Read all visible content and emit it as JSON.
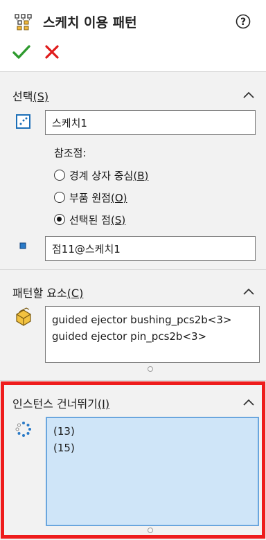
{
  "header": {
    "title": "스케치 이용 패턴",
    "icon": "sketch-pattern-icon",
    "help_icon": "help-icon",
    "ok_icon": "check-icon",
    "cancel_icon": "close-icon"
  },
  "selection": {
    "title": "선택",
    "shortcut": "(S)",
    "sketch_value": "스케치1",
    "reference_label": "참조점:",
    "options": [
      {
        "label": "경계 상자 중심",
        "shortcut": "(B)",
        "selected": false
      },
      {
        "label": "부품 원점",
        "shortcut": "(O)",
        "selected": false
      },
      {
        "label": "선택된 점",
        "shortcut": "(S)",
        "selected": true
      }
    ],
    "point_value": "점11@스케치1"
  },
  "features": {
    "title": "패턴할 요소",
    "shortcut": "(C)",
    "items": [
      "guided ejector bushing_pcs2b<3>",
      "guided ejector pin_pcs2b<3>"
    ]
  },
  "skip": {
    "title": "인스턴스 건너뛰기",
    "shortcut": "(I)",
    "items": [
      "(13)",
      "(15)"
    ]
  },
  "colors": {
    "ok": "#2e9a2e",
    "cancel": "#e01b1b",
    "highlight": "#ee1c1c",
    "selected_field": "#cfe5f8"
  }
}
